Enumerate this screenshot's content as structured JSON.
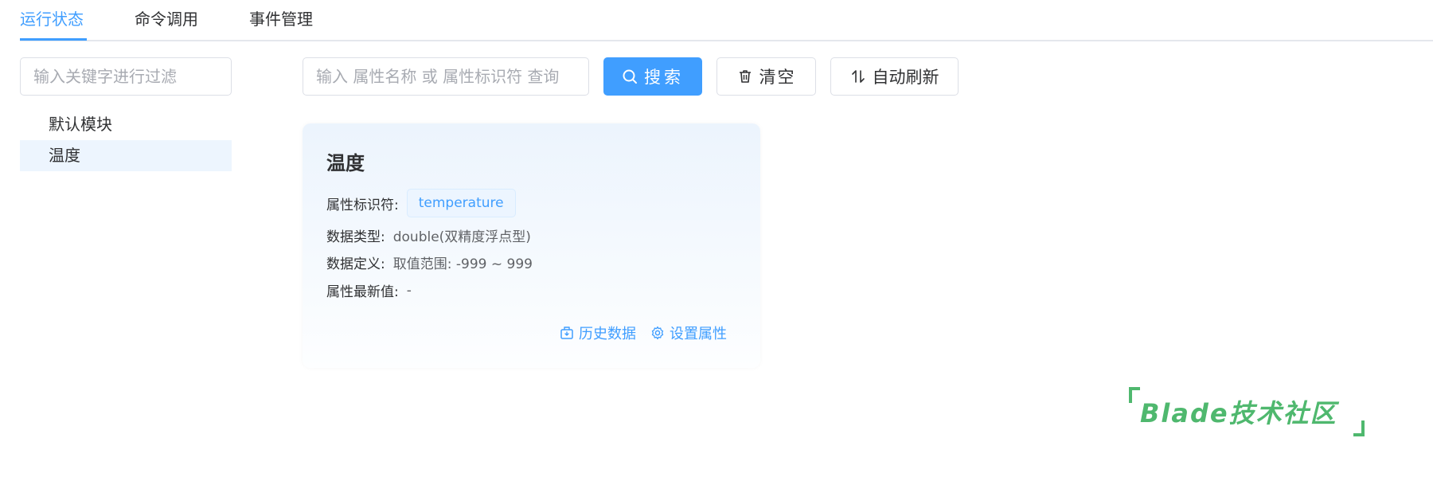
{
  "tabs": [
    {
      "label": "运行状态",
      "active": true
    },
    {
      "label": "命令调用",
      "active": false
    },
    {
      "label": "事件管理",
      "active": false
    }
  ],
  "filter": {
    "placeholder": "输入关键字进行过滤"
  },
  "tree": {
    "items": [
      {
        "label": "默认模块",
        "selected": false
      },
      {
        "label": "温度",
        "selected": true
      }
    ]
  },
  "toolbar": {
    "search_placeholder": "输入 属性名称 或 属性标识符 查询",
    "search_label": "搜索",
    "clear_label": "清空",
    "refresh_label": "自动刷新"
  },
  "property_card": {
    "title": "温度",
    "identifier_label": "属性标识符:",
    "identifier_value": "temperature",
    "datatype_label": "数据类型:",
    "datatype_value": "double(双精度浮点型)",
    "definition_label": "数据定义:",
    "definition_value": "取值范围: -999 ~ 999",
    "latest_label": "属性最新值:",
    "latest_value": "-",
    "history_label": "历史数据",
    "set_label": "设置属性"
  },
  "watermark": {
    "text": "Blade技术社区"
  },
  "colors": {
    "accent": "#409eff",
    "border": "#dcdfe6",
    "selected_bg": "#edf5fe",
    "watermark": "#4fb86e"
  }
}
